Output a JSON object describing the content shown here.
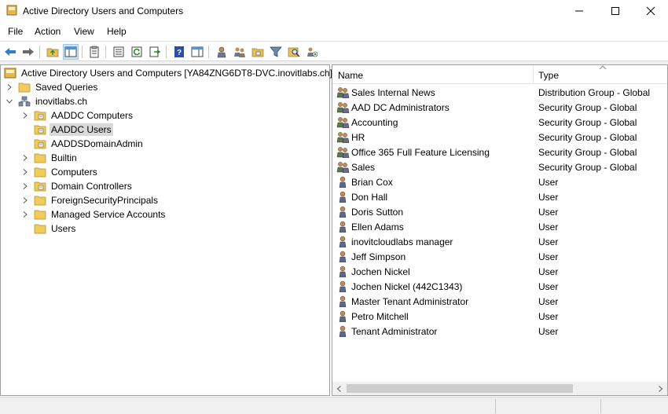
{
  "window": {
    "title": "Active Directory Users and Computers"
  },
  "menu": {
    "file": "File",
    "action": "Action",
    "view": "View",
    "help": "Help"
  },
  "toolbar": {
    "icons": [
      "back-arrow-icon",
      "forward-arrow-icon",
      "up-folder-icon",
      "show-console-tree-icon",
      "properties-icon",
      "export-list-icon",
      "refresh-icon",
      "export-icon",
      "help-icon",
      "show-action-pane-icon",
      "new-user-icon",
      "new-group-icon",
      "new-ou-icon",
      "filter-icon",
      "find-icon",
      "add-to-group-icon"
    ]
  },
  "tree": {
    "root": "Active Directory Users and Computers [YA84ZNG6DT8-DVC.inovitlabs.ch]",
    "saved_queries": "Saved Queries",
    "domain": "inovitlabs.ch",
    "children": [
      {
        "label": "AADDC Computers",
        "expandable": true,
        "type": "ou"
      },
      {
        "label": "AADDC Users",
        "expandable": false,
        "type": "ou",
        "selected": true
      },
      {
        "label": "AADDSDomainAdmin",
        "expandable": false,
        "type": "ou"
      },
      {
        "label": "Builtin",
        "expandable": true,
        "type": "folder"
      },
      {
        "label": "Computers",
        "expandable": true,
        "type": "folder"
      },
      {
        "label": "Domain Controllers",
        "expandable": true,
        "type": "ou"
      },
      {
        "label": "ForeignSecurityPrincipals",
        "expandable": true,
        "type": "folder"
      },
      {
        "label": "Managed Service Accounts",
        "expandable": true,
        "type": "folder"
      },
      {
        "label": "Users",
        "expandable": false,
        "type": "folder"
      }
    ]
  },
  "list": {
    "columns": {
      "name": "Name",
      "type": "Type"
    },
    "rows": [
      {
        "name": "Sales Internal News",
        "type": "Distribution Group - Global",
        "kind": "group"
      },
      {
        "name": "AAD DC Administrators",
        "type": "Security Group - Global",
        "kind": "group"
      },
      {
        "name": "Accounting",
        "type": "Security Group - Global",
        "kind": "group"
      },
      {
        "name": "HR",
        "type": "Security Group - Global",
        "kind": "group"
      },
      {
        "name": "Office 365 Full Feature Licensing",
        "type": "Security Group - Global",
        "kind": "group"
      },
      {
        "name": "Sales",
        "type": "Security Group - Global",
        "kind": "group"
      },
      {
        "name": "Brian Cox",
        "type": "User",
        "kind": "user"
      },
      {
        "name": "Don Hall",
        "type": "User",
        "kind": "user"
      },
      {
        "name": "Doris Sutton",
        "type": "User",
        "kind": "user"
      },
      {
        "name": "Ellen Adams",
        "type": "User",
        "kind": "user"
      },
      {
        "name": "inovitcloudlabs manager",
        "type": "User",
        "kind": "user"
      },
      {
        "name": "Jeff Simpson",
        "type": "User",
        "kind": "user"
      },
      {
        "name": "Jochen Nickel",
        "type": "User",
        "kind": "user"
      },
      {
        "name": "Jochen Nickel (442C1343)",
        "type": "User",
        "kind": "user"
      },
      {
        "name": "Master Tenant Administrator",
        "type": "User",
        "kind": "user"
      },
      {
        "name": "Petro Mitchell",
        "type": "User",
        "kind": "user"
      },
      {
        "name": "Tenant Administrator",
        "type": "User",
        "kind": "user"
      }
    ]
  }
}
